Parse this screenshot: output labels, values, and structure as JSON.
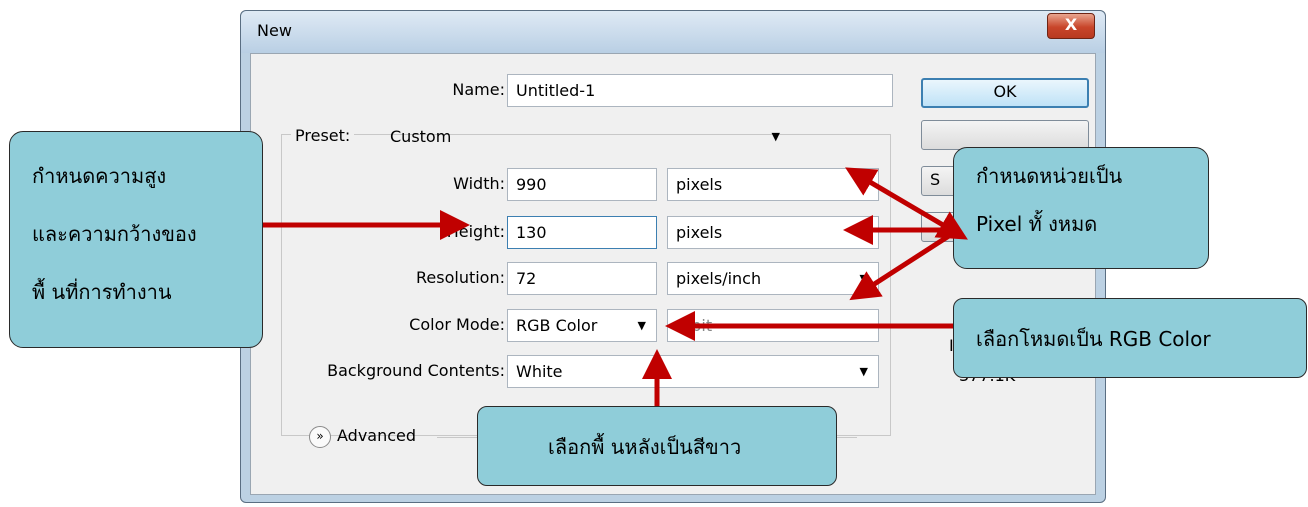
{
  "dialog": {
    "title": "New",
    "close_label": "X",
    "name_label": "Name:",
    "name_value": "Untitled-1",
    "preset_label": "Preset:",
    "preset_value": "Custom",
    "width_label": "Width:",
    "width_value": "990",
    "width_unit": "pixels",
    "height_label": "Height:",
    "height_value": "130",
    "height_unit": "pixels",
    "resolution_label": "Resolution:",
    "resolution_value": "72",
    "resolution_unit": "pixels/inch",
    "color_mode_label": "Color Mode:",
    "color_mode_value": "RGB Color",
    "bit_depth_value": "8 bit",
    "background_label": "Background Contents:",
    "background_value": "White",
    "advanced_label": "Advanced",
    "ok_label": "OK",
    "save_preset_label_partial": "S",
    "image_size_partial": "I",
    "image_size_value": "377.1K"
  },
  "callouts": {
    "size_lines": [
      "กำหนดความสูง",
      "และความกว้างของ",
      "พื้ นที่การทำงาน"
    ],
    "unit_line1": "กำหนดหน่วยเป็น",
    "unit_line2": "Pixel ทั้ งหมด",
    "mode_text": "เลือกโหมดเป็น RGB Color",
    "background_text": "เลือกพื้ นหลังเป็นสีขาว"
  },
  "colors": {
    "callout_fill": "#8fcdd9",
    "arrow": "#c00000",
    "window_frame": "#bcd1e3"
  }
}
